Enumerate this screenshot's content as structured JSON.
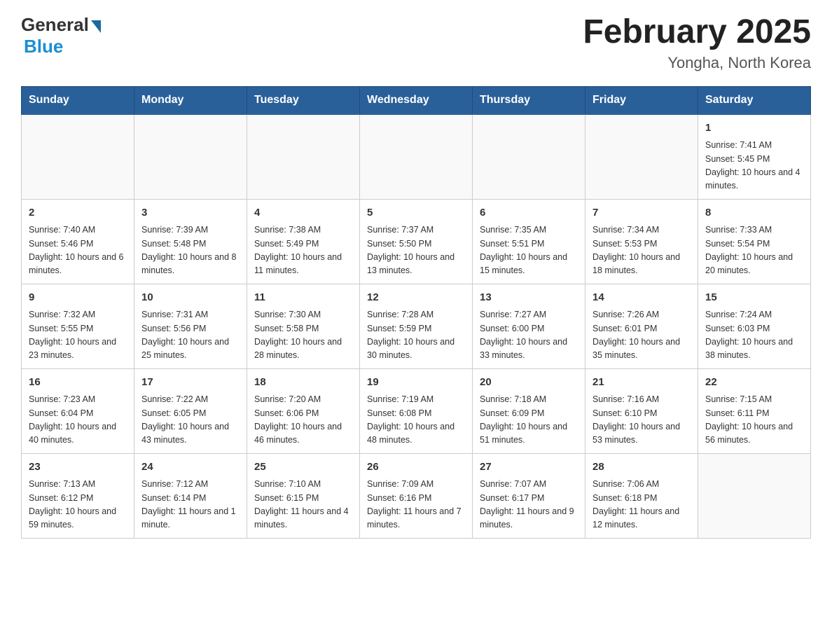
{
  "logo": {
    "general": "General",
    "blue": "Blue"
  },
  "title": "February 2025",
  "subtitle": "Yongha, North Korea",
  "days": [
    "Sunday",
    "Monday",
    "Tuesday",
    "Wednesday",
    "Thursday",
    "Friday",
    "Saturday"
  ],
  "weeks": [
    [
      {
        "day": "",
        "info": ""
      },
      {
        "day": "",
        "info": ""
      },
      {
        "day": "",
        "info": ""
      },
      {
        "day": "",
        "info": ""
      },
      {
        "day": "",
        "info": ""
      },
      {
        "day": "",
        "info": ""
      },
      {
        "day": "1",
        "info": "Sunrise: 7:41 AM\nSunset: 5:45 PM\nDaylight: 10 hours and 4 minutes."
      }
    ],
    [
      {
        "day": "2",
        "info": "Sunrise: 7:40 AM\nSunset: 5:46 PM\nDaylight: 10 hours and 6 minutes."
      },
      {
        "day": "3",
        "info": "Sunrise: 7:39 AM\nSunset: 5:48 PM\nDaylight: 10 hours and 8 minutes."
      },
      {
        "day": "4",
        "info": "Sunrise: 7:38 AM\nSunset: 5:49 PM\nDaylight: 10 hours and 11 minutes."
      },
      {
        "day": "5",
        "info": "Sunrise: 7:37 AM\nSunset: 5:50 PM\nDaylight: 10 hours and 13 minutes."
      },
      {
        "day": "6",
        "info": "Sunrise: 7:35 AM\nSunset: 5:51 PM\nDaylight: 10 hours and 15 minutes."
      },
      {
        "day": "7",
        "info": "Sunrise: 7:34 AM\nSunset: 5:53 PM\nDaylight: 10 hours and 18 minutes."
      },
      {
        "day": "8",
        "info": "Sunrise: 7:33 AM\nSunset: 5:54 PM\nDaylight: 10 hours and 20 minutes."
      }
    ],
    [
      {
        "day": "9",
        "info": "Sunrise: 7:32 AM\nSunset: 5:55 PM\nDaylight: 10 hours and 23 minutes."
      },
      {
        "day": "10",
        "info": "Sunrise: 7:31 AM\nSunset: 5:56 PM\nDaylight: 10 hours and 25 minutes."
      },
      {
        "day": "11",
        "info": "Sunrise: 7:30 AM\nSunset: 5:58 PM\nDaylight: 10 hours and 28 minutes."
      },
      {
        "day": "12",
        "info": "Sunrise: 7:28 AM\nSunset: 5:59 PM\nDaylight: 10 hours and 30 minutes."
      },
      {
        "day": "13",
        "info": "Sunrise: 7:27 AM\nSunset: 6:00 PM\nDaylight: 10 hours and 33 minutes."
      },
      {
        "day": "14",
        "info": "Sunrise: 7:26 AM\nSunset: 6:01 PM\nDaylight: 10 hours and 35 minutes."
      },
      {
        "day": "15",
        "info": "Sunrise: 7:24 AM\nSunset: 6:03 PM\nDaylight: 10 hours and 38 minutes."
      }
    ],
    [
      {
        "day": "16",
        "info": "Sunrise: 7:23 AM\nSunset: 6:04 PM\nDaylight: 10 hours and 40 minutes."
      },
      {
        "day": "17",
        "info": "Sunrise: 7:22 AM\nSunset: 6:05 PM\nDaylight: 10 hours and 43 minutes."
      },
      {
        "day": "18",
        "info": "Sunrise: 7:20 AM\nSunset: 6:06 PM\nDaylight: 10 hours and 46 minutes."
      },
      {
        "day": "19",
        "info": "Sunrise: 7:19 AM\nSunset: 6:08 PM\nDaylight: 10 hours and 48 minutes."
      },
      {
        "day": "20",
        "info": "Sunrise: 7:18 AM\nSunset: 6:09 PM\nDaylight: 10 hours and 51 minutes."
      },
      {
        "day": "21",
        "info": "Sunrise: 7:16 AM\nSunset: 6:10 PM\nDaylight: 10 hours and 53 minutes."
      },
      {
        "day": "22",
        "info": "Sunrise: 7:15 AM\nSunset: 6:11 PM\nDaylight: 10 hours and 56 minutes."
      }
    ],
    [
      {
        "day": "23",
        "info": "Sunrise: 7:13 AM\nSunset: 6:12 PM\nDaylight: 10 hours and 59 minutes."
      },
      {
        "day": "24",
        "info": "Sunrise: 7:12 AM\nSunset: 6:14 PM\nDaylight: 11 hours and 1 minute."
      },
      {
        "day": "25",
        "info": "Sunrise: 7:10 AM\nSunset: 6:15 PM\nDaylight: 11 hours and 4 minutes."
      },
      {
        "day": "26",
        "info": "Sunrise: 7:09 AM\nSunset: 6:16 PM\nDaylight: 11 hours and 7 minutes."
      },
      {
        "day": "27",
        "info": "Sunrise: 7:07 AM\nSunset: 6:17 PM\nDaylight: 11 hours and 9 minutes."
      },
      {
        "day": "28",
        "info": "Sunrise: 7:06 AM\nSunset: 6:18 PM\nDaylight: 11 hours and 12 minutes."
      },
      {
        "day": "",
        "info": ""
      }
    ]
  ]
}
